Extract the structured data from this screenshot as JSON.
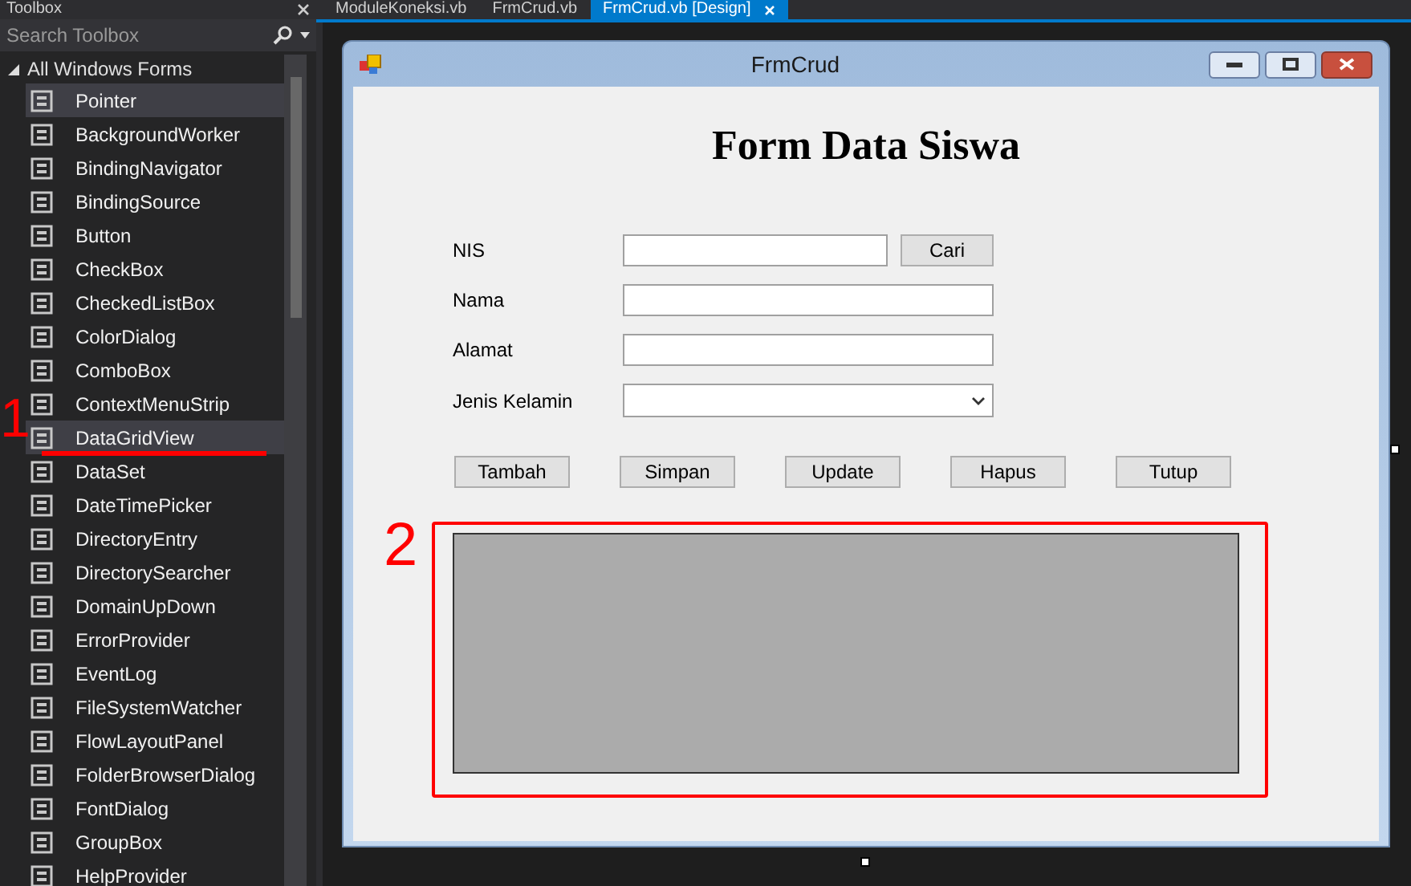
{
  "toolbox": {
    "title": "Toolbox",
    "search": {
      "placeholder": "Search Toolbox"
    },
    "group": {
      "label": "All Windows Forms",
      "expanded": true
    },
    "items": [
      {
        "label": "Pointer",
        "selected": true
      },
      {
        "label": "BackgroundWorker",
        "selected": false
      },
      {
        "label": "BindingNavigator",
        "selected": false
      },
      {
        "label": "BindingSource",
        "selected": false
      },
      {
        "label": "Button",
        "selected": false
      },
      {
        "label": "CheckBox",
        "selected": false
      },
      {
        "label": "CheckedListBox",
        "selected": false
      },
      {
        "label": "ColorDialog",
        "selected": false
      },
      {
        "label": "ComboBox",
        "selected": false
      },
      {
        "label": "ContextMenuStrip",
        "selected": false
      },
      {
        "label": "DataGridView",
        "selected": true
      },
      {
        "label": "DataSet",
        "selected": false
      },
      {
        "label": "DateTimePicker",
        "selected": false
      },
      {
        "label": "DirectoryEntry",
        "selected": false
      },
      {
        "label": "DirectorySearcher",
        "selected": false
      },
      {
        "label": "DomainUpDown",
        "selected": false
      },
      {
        "label": "ErrorProvider",
        "selected": false
      },
      {
        "label": "EventLog",
        "selected": false
      },
      {
        "label": "FileSystemWatcher",
        "selected": false
      },
      {
        "label": "FlowLayoutPanel",
        "selected": false
      },
      {
        "label": "FolderBrowserDialog",
        "selected": false
      },
      {
        "label": "FontDialog",
        "selected": false
      },
      {
        "label": "GroupBox",
        "selected": false
      },
      {
        "label": "HelpProvider",
        "selected": false
      }
    ]
  },
  "tabs": [
    {
      "label": "ModuleKoneksi.vb",
      "selected": false
    },
    {
      "label": "FrmCrud.vb",
      "selected": false
    },
    {
      "label": "FrmCrud.vb [Design]",
      "selected": true
    }
  ],
  "form": {
    "title": "FrmCrud",
    "heading": "Form Data Siswa",
    "fields": [
      {
        "label": "NIS",
        "kind": "text",
        "button": "Cari"
      },
      {
        "label": "Nama",
        "kind": "text"
      },
      {
        "label": "Alamat",
        "kind": "text"
      },
      {
        "label": "Jenis Kelamin",
        "kind": "combo"
      }
    ],
    "buttons": [
      "Tambah",
      "Simpan",
      "Update",
      "Hapus",
      "Tutup"
    ]
  },
  "annotations": [
    {
      "label": "1"
    },
    {
      "label": "2"
    }
  ]
}
